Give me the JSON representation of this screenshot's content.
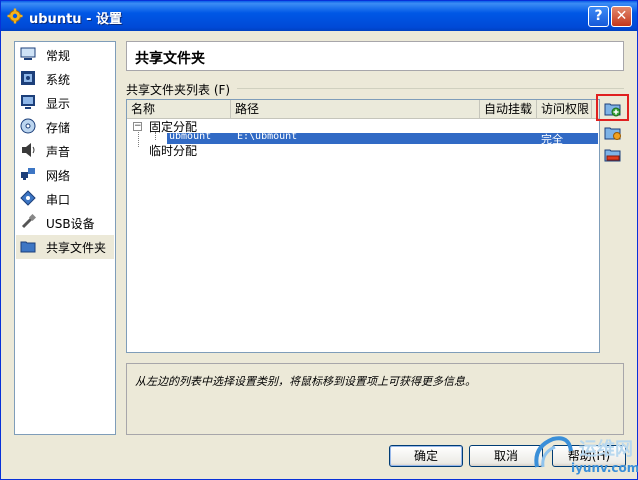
{
  "window": {
    "title": "ubuntu - 设置",
    "help_btn": "?",
    "close_btn": "✕"
  },
  "sidebar": {
    "items": [
      {
        "label": "常规",
        "icon": "general-icon"
      },
      {
        "label": "系统",
        "icon": "system-icon"
      },
      {
        "label": "显示",
        "icon": "display-icon"
      },
      {
        "label": "存储",
        "icon": "storage-icon"
      },
      {
        "label": "声音",
        "icon": "audio-icon"
      },
      {
        "label": "网络",
        "icon": "network-icon"
      },
      {
        "label": "串口",
        "icon": "serial-port-icon"
      },
      {
        "label": "USB设备",
        "icon": "usb-icon"
      },
      {
        "label": "共享文件夹",
        "icon": "shared-folder-icon",
        "selected": true
      }
    ]
  },
  "page": {
    "title": "共享文件夹",
    "list_label": "共享文件夹列表",
    "list_label_mnemonic": "(F)"
  },
  "table": {
    "headers": [
      "名称",
      "路径",
      "自动挂载",
      "访问权限"
    ],
    "groups": [
      {
        "label": "固定分配",
        "rows": [
          {
            "name": "ubmount",
            "path": "E:\\ubmount",
            "auto_mount": "",
            "access": "完全"
          }
        ]
      },
      {
        "label": "临时分配",
        "rows": []
      }
    ]
  },
  "side_buttons": [
    "add-shared-folder-icon",
    "edit-shared-folder-icon",
    "remove-shared-folder-icon"
  ],
  "info": {
    "text": "从左边的列表中选择设置类别，将鼠标移到设置项上可获得更多信息。"
  },
  "buttons": {
    "ok": "确定",
    "cancel": "取消",
    "help": "帮助(H)"
  },
  "watermark": {
    "line1": "运维网",
    "line2": "iyunv.com"
  },
  "colors": {
    "title_bar": "#0058e6",
    "selection": "#316ac5",
    "highlight_box": "#e02020"
  }
}
